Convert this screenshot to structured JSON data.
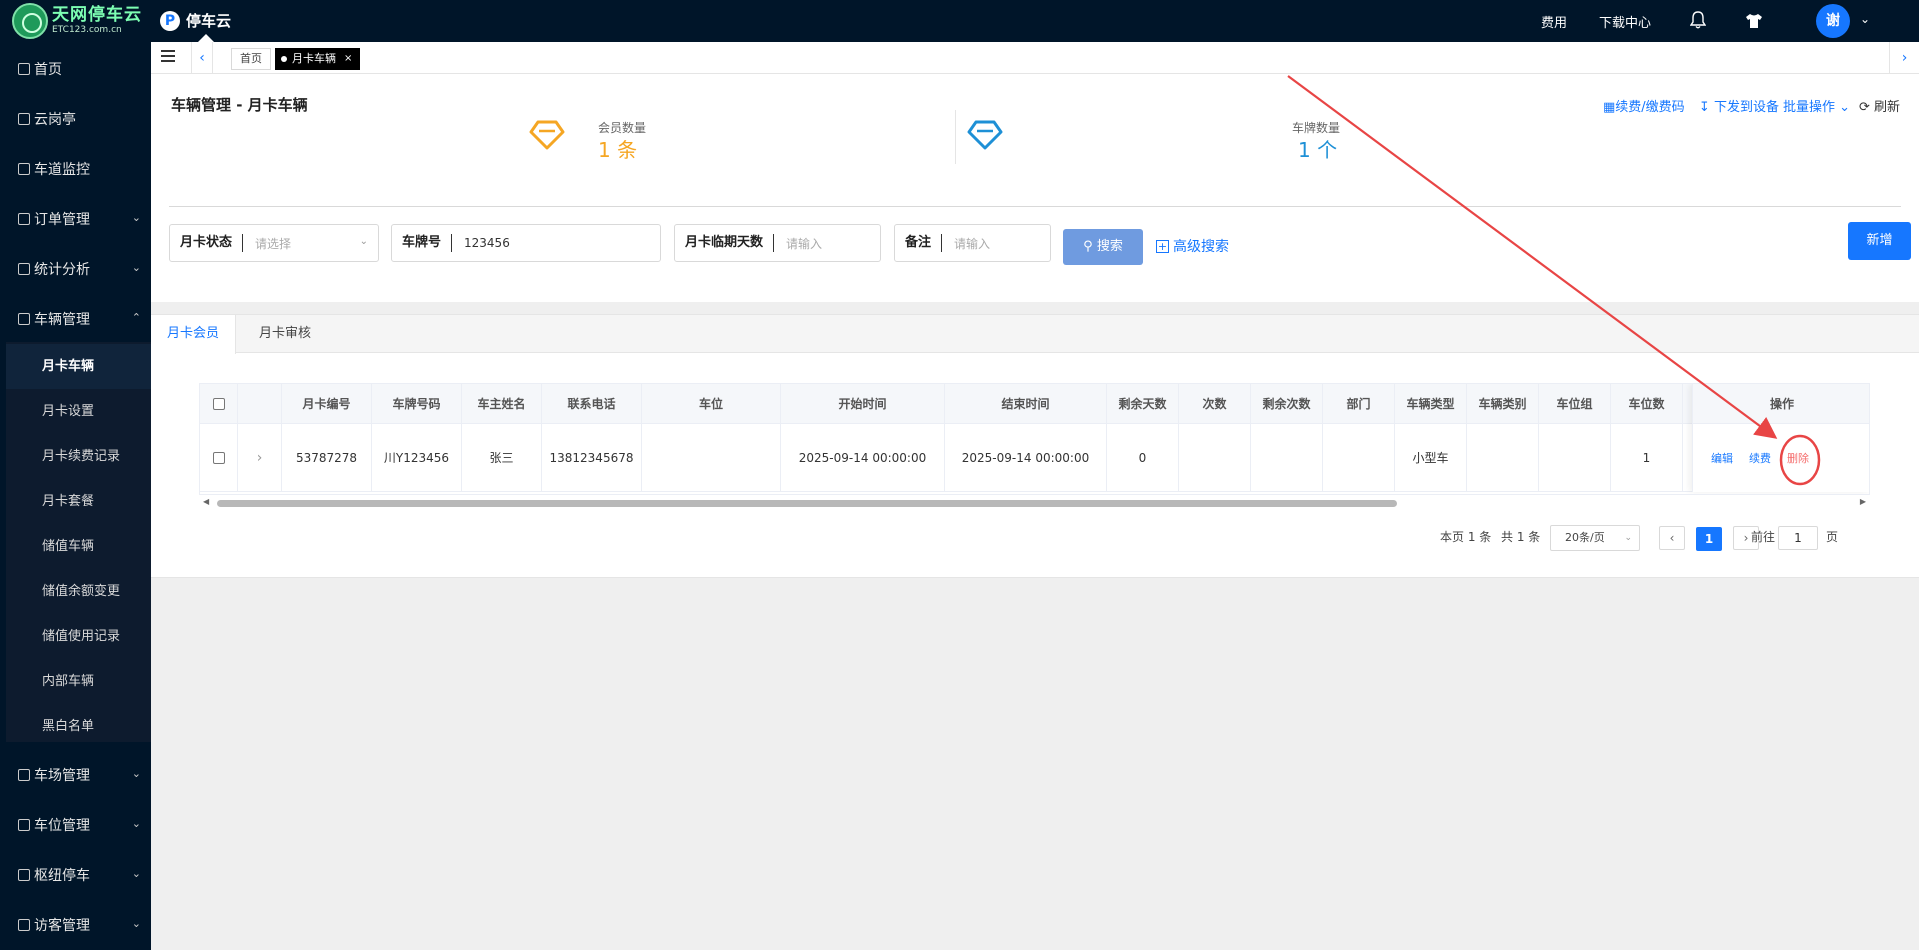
{
  "app": {
    "logo_cn": "天网停车云",
    "logo_en": "ETC123.com.cn",
    "brand": "停车云",
    "brand_icon": "P",
    "nav_links": [
      "费用",
      "下载中心"
    ],
    "user_initial": "谢"
  },
  "sidebar": {
    "items": [
      {
        "label": "首页",
        "icon": "home-icon"
      },
      {
        "label": "云岗亭",
        "icon": "booth-icon"
      },
      {
        "label": "车道监控",
        "icon": "monitor-icon"
      },
      {
        "label": "订单管理",
        "icon": "order-icon"
      },
      {
        "label": "统计分析",
        "icon": "stats-icon"
      },
      {
        "label": "车辆管理",
        "icon": "car-icon"
      },
      {
        "label": "车场管理",
        "icon": "lot-icon"
      },
      {
        "label": "车位管理",
        "icon": "space-icon"
      },
      {
        "label": "枢纽停车",
        "icon": "hub-icon"
      },
      {
        "label": "访客管理",
        "icon": "visitor-icon"
      }
    ],
    "subitems": [
      "月卡车辆",
      "月卡设置",
      "月卡续费记录",
      "月卡套餐",
      "储值车辆",
      "储值余额变更",
      "储值使用记录",
      "内部车辆",
      "黑白名单"
    ],
    "active_sub": "月卡车辆"
  },
  "tabs": {
    "home": "首页",
    "active": "月卡车辆",
    "close": "×"
  },
  "header": {
    "title": "车辆管理 - 月卡车辆",
    "renew_code": "续费/缴费码",
    "issue_device": "下发到设备",
    "batch": "批量操作",
    "refresh": "刷新"
  },
  "stats": {
    "members_label": "会员数量",
    "members_value": "1 条",
    "plates_label": "车牌数量",
    "plates_value": "1 个",
    "members_color": "#f5a623",
    "plates_color": "#1e90d6"
  },
  "filters": {
    "status_label": "月卡状态",
    "status_placeholder": "请选择",
    "plate_label": "车牌号",
    "plate_value": "123456",
    "expiry_label": "月卡临期天数",
    "expiry_placeholder": "请输入",
    "note_label": "备注",
    "note_placeholder": "请输入",
    "search": "搜索",
    "advanced": "高级搜索",
    "add": "新增"
  },
  "subtabs": [
    "月卡会员",
    "月卡审核"
  ],
  "table": {
    "columns": [
      "月卡编号",
      "车牌号码",
      "车主姓名",
      "联系电话",
      "车位",
      "开始时间",
      "结束时间",
      "剩余天数",
      "次数",
      "剩余次数",
      "部门",
      "车辆类型",
      "车辆类别",
      "车位组",
      "车位数"
    ],
    "op_header": "操作",
    "row": [
      "53787278",
      "川Y123456",
      "张三",
      "13812345678",
      "",
      "2025-09-14 00:00:00",
      "2025-09-14 00:00:00",
      "0",
      "",
      "",
      "",
      "小型车",
      "",
      "",
      "1"
    ],
    "ops": [
      "编辑",
      "续费",
      "删除"
    ]
  },
  "pager": {
    "page_info": "本页 1 条",
    "total": "共 1 条",
    "size": "20条/页",
    "current": "1",
    "goto_label": "前往",
    "goto_value": "1",
    "page_suffix": "页"
  },
  "colors": {
    "accent": "#1677ff",
    "sidebar": "#001529",
    "annotation": "#e84545"
  }
}
